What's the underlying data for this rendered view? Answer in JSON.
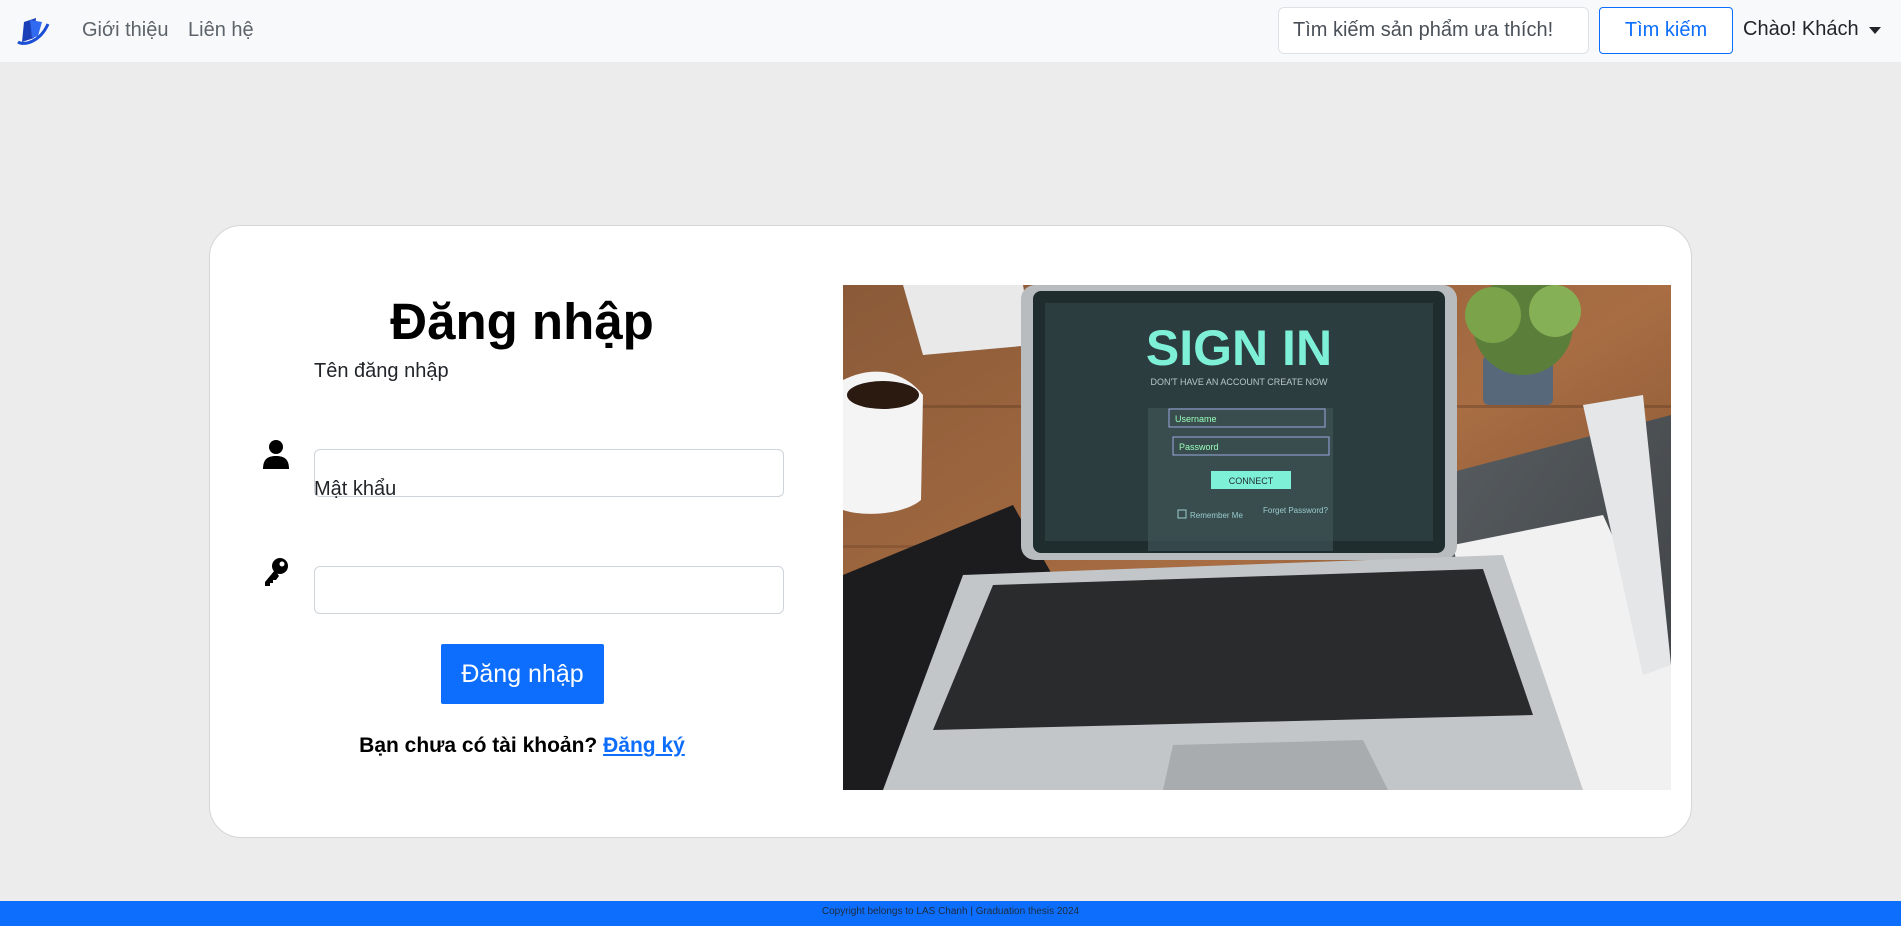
{
  "navbar": {
    "brand_icon": "blue-swoosh-logo-icon",
    "links": [
      "Giới thiệu",
      "Liên hệ"
    ],
    "search_placeholder": "Tìm kiếm sản phẩm ưa thích!",
    "search_button": "Tìm kiếm",
    "user_menu": "Chào! Khách",
    "accent": "#0d6efd"
  },
  "login": {
    "title": "Đăng nhập",
    "username_label": "Tên đăng nhập",
    "username_icon": "user-icon",
    "password_label": "Mật khẩu",
    "password_icon": "key-icon",
    "submit_label": "Đăng nhập",
    "signup_prompt": "Bạn chưa có tài khoản?",
    "signup_link": "Đăng ký"
  },
  "illustration": {
    "screen_title": "SIGN IN",
    "screen_subtitle": "DON'T HAVE AN ACCOUNT CREATE NOW",
    "username_placeholder": "Username",
    "password_placeholder": "Password",
    "connect_label": "CONNECT",
    "remember_label": "Remember Me",
    "forgot_label": "Forget Password?"
  },
  "footer": {
    "text": "Copyright belongs to LAS Chanh | Graduation thesis 2024"
  }
}
